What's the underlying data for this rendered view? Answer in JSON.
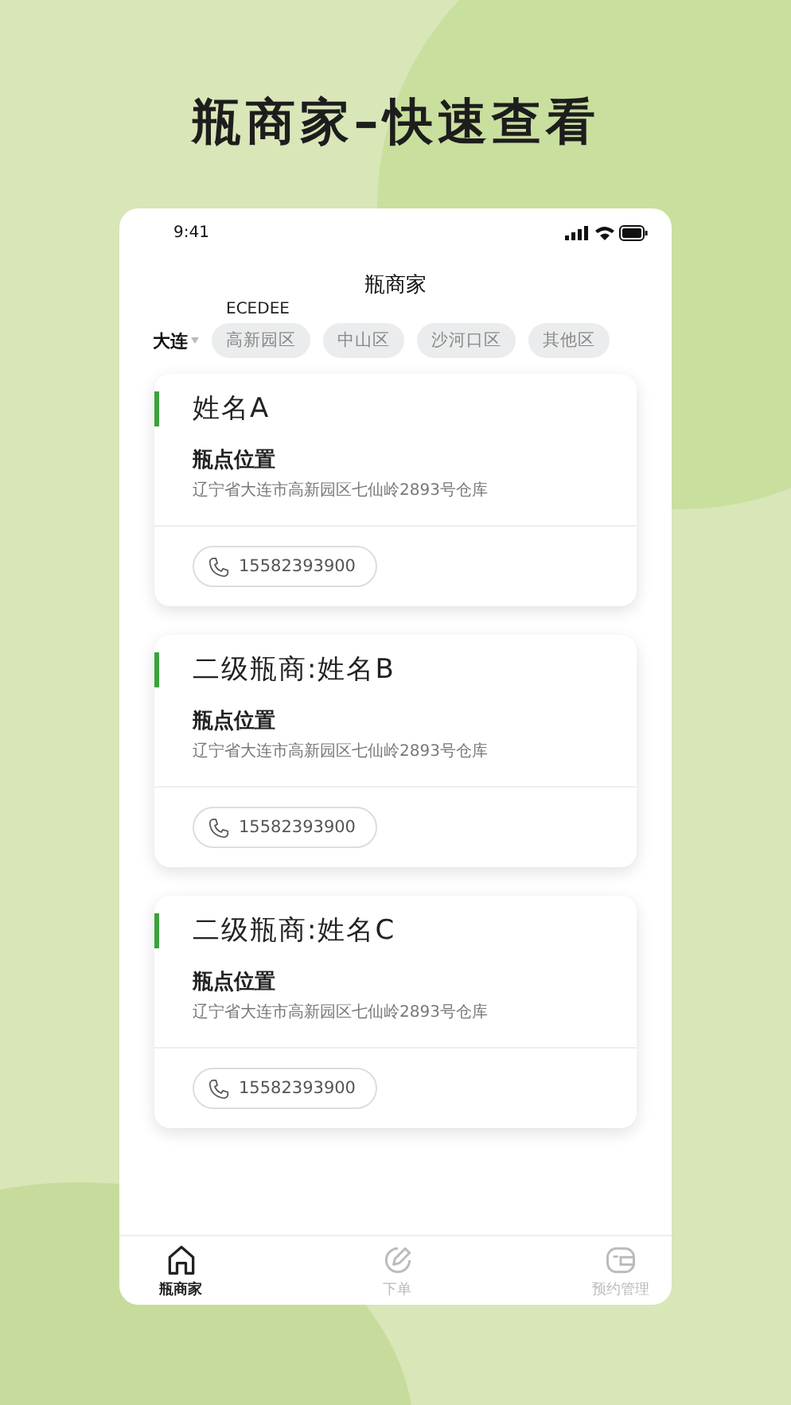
{
  "headline": "瓶商家–快速查看",
  "status_bar": {
    "time": "9:41"
  },
  "header": {
    "title": "瓶商家",
    "note": "ECEDEE"
  },
  "filter": {
    "city": "大连",
    "districts": [
      "高新园区",
      "中山区",
      "沙河口区",
      "其他区"
    ]
  },
  "cards": [
    {
      "name": "姓名A",
      "location_label": "瓶点位置",
      "address": "辽宁省大连市高新园区七仙岭2893号仓库",
      "phone": "15582393900"
    },
    {
      "name": "二级瓶商:姓名B",
      "location_label": "瓶点位置",
      "address": "辽宁省大连市高新园区七仙岭2893号仓库",
      "phone": "15582393900"
    },
    {
      "name": "二级瓶商:姓名C",
      "location_label": "瓶点位置",
      "address": "辽宁省大连市高新园区七仙岭2893号仓库",
      "phone": "15582393900"
    }
  ],
  "tab_bar": [
    {
      "label": "瓶商家",
      "kind": "home",
      "selected": true
    },
    {
      "label": "下单",
      "kind": "order",
      "selected": false
    },
    {
      "label": "预约管理",
      "kind": "wallet",
      "selected": false
    }
  ]
}
